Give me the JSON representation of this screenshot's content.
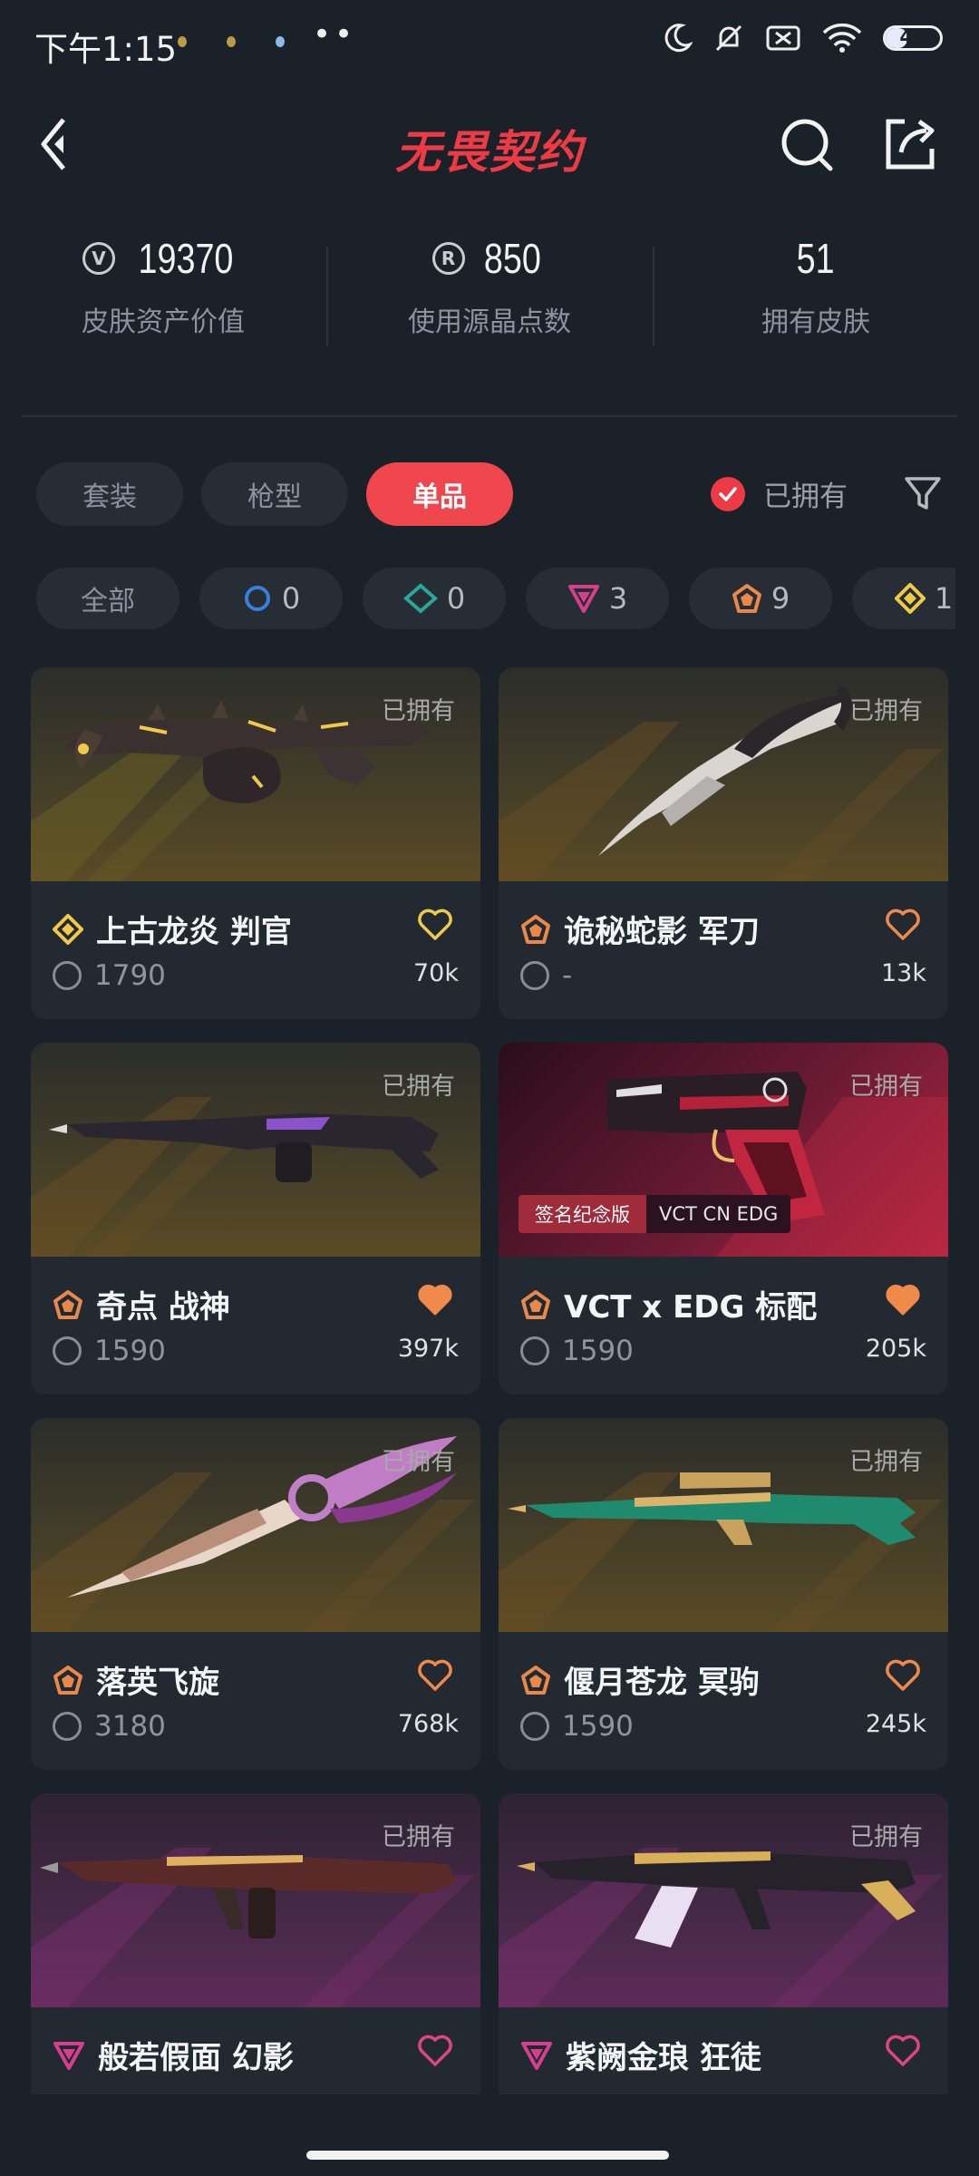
{
  "status_bar": {
    "time": "下午1:15",
    "more": "••",
    "battery_level": "40",
    "battery_fraction": 0.4
  },
  "header": {
    "brand": "无畏契约",
    "icons": {
      "back": "back-arrow-icon",
      "search": "search-icon",
      "share": "share-icon"
    }
  },
  "stats": [
    {
      "value": "19370",
      "label": "皮肤资产价值",
      "icon": "vp-coin-icon"
    },
    {
      "value": "850",
      "label": "使用源晶点数",
      "icon": "radianite-coin-icon"
    },
    {
      "value": "51",
      "label": "拥有皮肤",
      "icon": ""
    }
  ],
  "tabs": [
    "套装",
    "枪型",
    "单品"
  ],
  "active_tab": "单品",
  "owned_filter": {
    "label": "已拥有",
    "checked": true
  },
  "tiers": [
    {
      "label": "全部",
      "count": ""
    },
    {
      "label": "",
      "count": "0",
      "icon": "select-tier-icon",
      "color": "#3b7fd6"
    },
    {
      "label": "",
      "count": "0",
      "icon": "deluxe-tier-icon",
      "color": "#2ba59a"
    },
    {
      "label": "",
      "count": "3",
      "icon": "premium-tier-icon",
      "color": "#d63f8e"
    },
    {
      "label": "",
      "count": "9",
      "icon": "exclusive-tier-icon",
      "color": "#e8894b"
    },
    {
      "label": "",
      "count": "1",
      "icon": "ultra-tier-icon",
      "color": "#f0c94b"
    }
  ],
  "cards": [
    {
      "name": "上古龙炎 判官",
      "price": "1790",
      "likes": "70k",
      "owned": "已拥有",
      "tier": "ultra",
      "liked": false,
      "bg": "gold"
    },
    {
      "name": "诡秘蛇影 军刀",
      "price": "-",
      "likes": "13k",
      "owned": "已拥有",
      "tier": "exclusive",
      "liked": false,
      "bg": "gold"
    },
    {
      "name": "奇点 战神",
      "price": "1590",
      "likes": "397k",
      "owned": "已拥有",
      "tier": "exclusive",
      "liked": true,
      "bg": "gold"
    },
    {
      "name": "VCT x EDG 标配",
      "price": "1590",
      "likes": "205k",
      "owned": "已拥有",
      "tier": "exclusive",
      "liked": true,
      "bg": "edg",
      "badge_a": "签名纪念版",
      "badge_b": "VCT CN EDG"
    },
    {
      "name": "落英飞旋",
      "price": "3180",
      "likes": "768k",
      "owned": "已拥有",
      "tier": "exclusive",
      "liked": false,
      "bg": "gold"
    },
    {
      "name": "偃月苍龙 冥驹",
      "price": "1590",
      "likes": "245k",
      "owned": "已拥有",
      "tier": "exclusive",
      "liked": false,
      "bg": "gold"
    },
    {
      "name": "般若假面 幻影",
      "price": "",
      "likes": "",
      "owned": "已拥有",
      "tier": "premium",
      "liked": false,
      "bg": "purple"
    },
    {
      "name": "紫阙金琅 狂徒",
      "price": "",
      "likes": "",
      "owned": "已拥有",
      "tier": "premium",
      "liked": false,
      "bg": "purple"
    }
  ],
  "colors": {
    "accent": "#f0474e",
    "background": "#1b2129",
    "card": "#222931",
    "heart_orange": "#f08a4b",
    "heart_pink": "#e0457e",
    "ultra": "#f0c94b",
    "exclusive": "#e8894b",
    "premium": "#d63f8e"
  }
}
